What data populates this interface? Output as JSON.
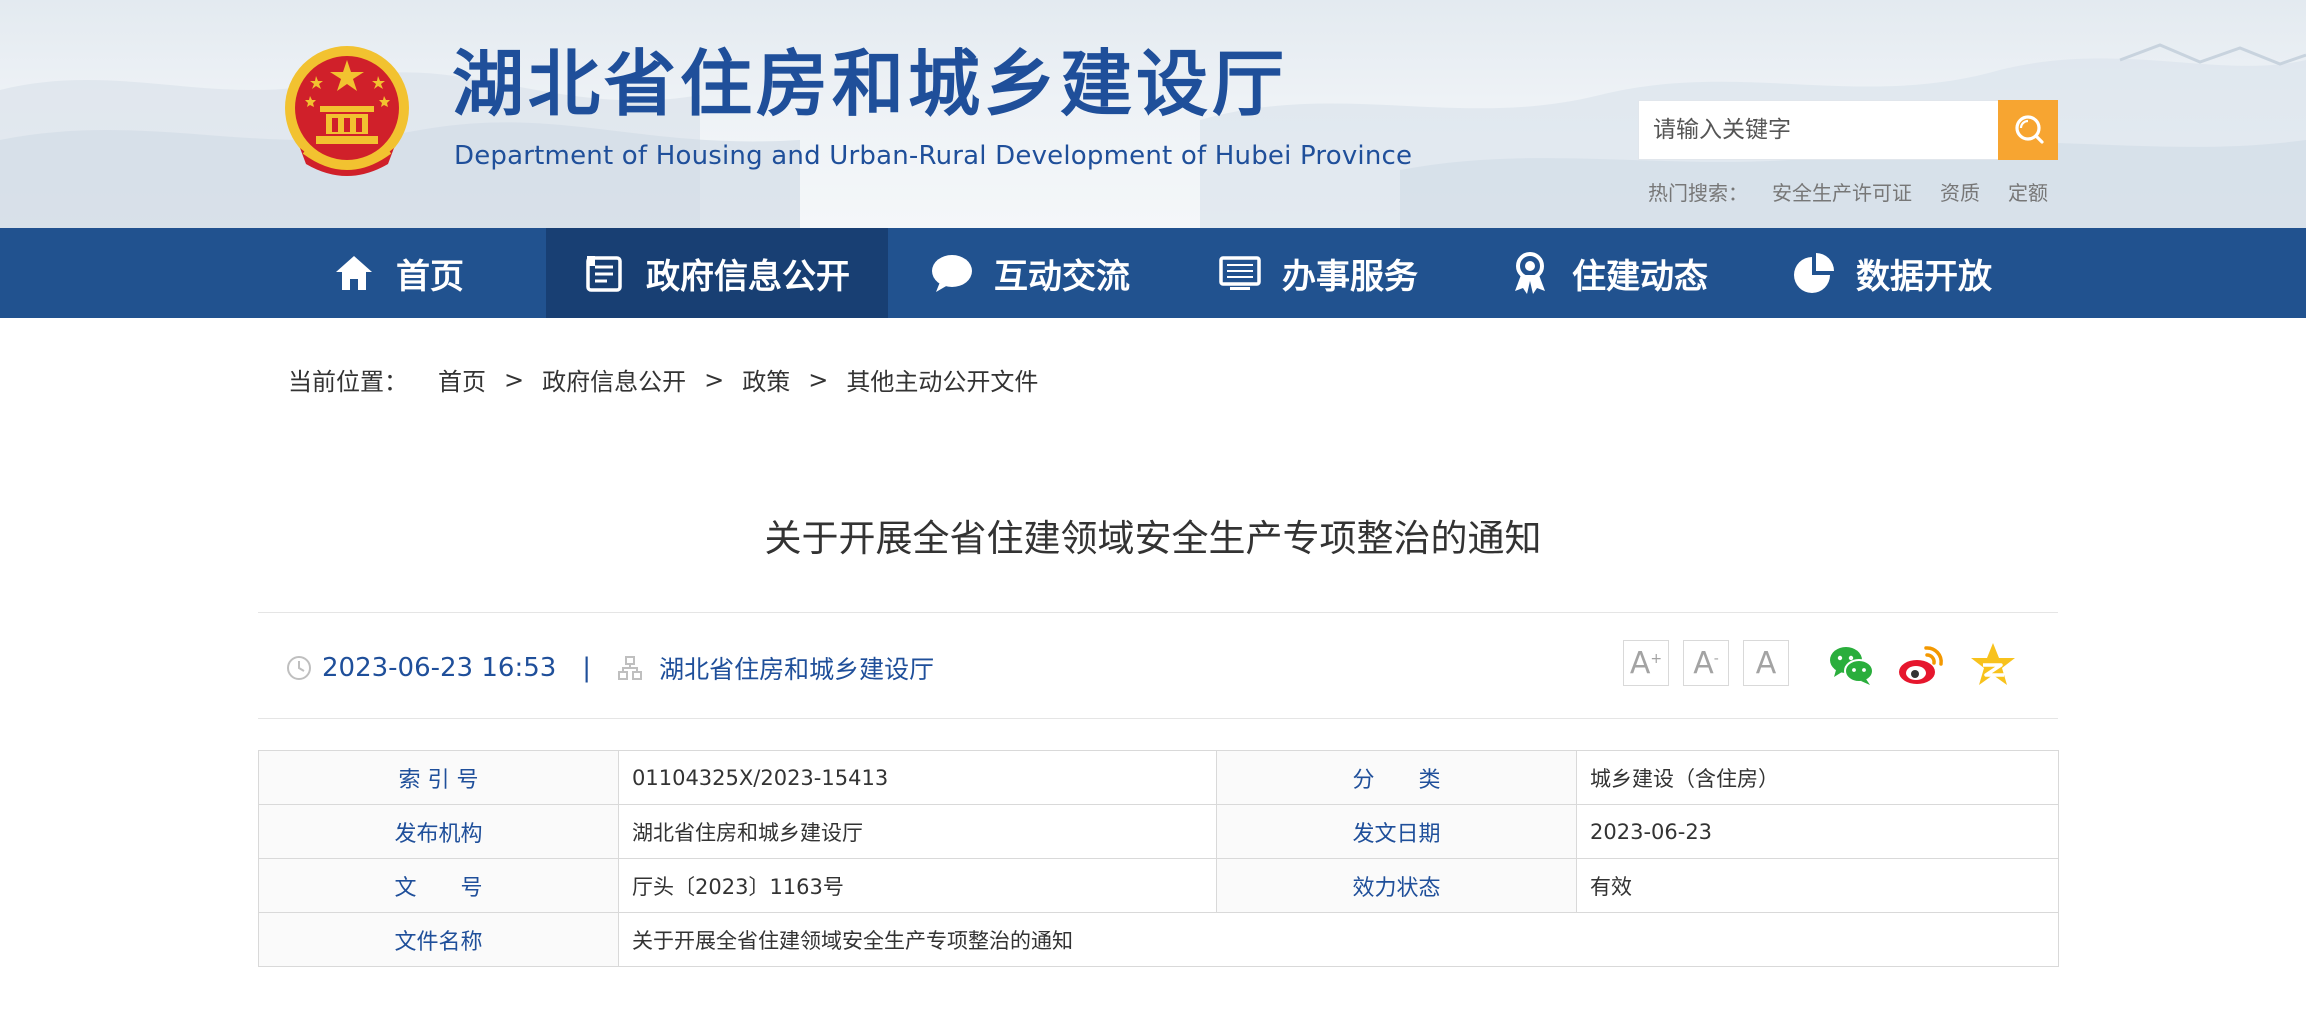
{
  "header": {
    "site_title": "湖北省住房和城乡建设厅",
    "site_subtitle": "Department of Housing and Urban-Rural Development of Hubei Province",
    "search_placeholder": "请输入关键字",
    "hot_search_label": "热门搜索：",
    "hot_search_items": [
      "安全生产许可证",
      "资质",
      "定额"
    ]
  },
  "nav": {
    "items": [
      {
        "label": "首页",
        "icon": "home-icon"
      },
      {
        "label": "政府信息公开",
        "icon": "document-icon",
        "active": true
      },
      {
        "label": "互动交流",
        "icon": "chat-bubble-icon"
      },
      {
        "label": "办事服务",
        "icon": "monitor-icon"
      },
      {
        "label": "住建动态",
        "icon": "award-ribbon-icon"
      },
      {
        "label": "数据开放",
        "icon": "pie-chart-icon"
      }
    ]
  },
  "breadcrumb": {
    "label": "当前位置：",
    "items": [
      "首页",
      "政府信息公开",
      "政策",
      "其他主动公开文件"
    ],
    "separator": ">"
  },
  "article": {
    "title": "关于开展全省住建领域安全生产专项整治的通知",
    "datetime": "2023-06-23 16:53",
    "separator": "|",
    "source": "湖北省住房和城乡建设厅",
    "font_sizes": [
      {
        "letter": "A",
        "sup": "+"
      },
      {
        "letter": "A",
        "sup": "-"
      },
      {
        "letter": "A",
        "sup": ""
      }
    ],
    "share_icons": [
      "wechat-icon",
      "weibo-icon",
      "qzone-icon"
    ]
  },
  "info_table": {
    "rows": [
      [
        {
          "k": "索 引 号",
          "v": "01104325X/2023-15413"
        },
        {
          "k": "分　　类",
          "v": "城乡建设（含住房）"
        }
      ],
      [
        {
          "k": "发布机构",
          "v": "湖北省住房和城乡建设厅"
        },
        {
          "k": "发文日期",
          "v": "2023-06-23"
        }
      ],
      [
        {
          "k": "文　　号",
          "v": "厅头〔2023〕1163号"
        },
        {
          "k": "效力状态",
          "v": "有效"
        }
      ],
      [
        {
          "k": "文件名称",
          "v": "关于开展全省住建领域安全生产专项整治的通知"
        }
      ]
    ]
  },
  "colors": {
    "brand_blue": "#21528f",
    "nav_active": "#183f73",
    "text_blue": "#1f4f9a",
    "search_orange": "#f7a531",
    "emblem_red": "#d0202a",
    "emblem_gold": "#f2c230"
  }
}
